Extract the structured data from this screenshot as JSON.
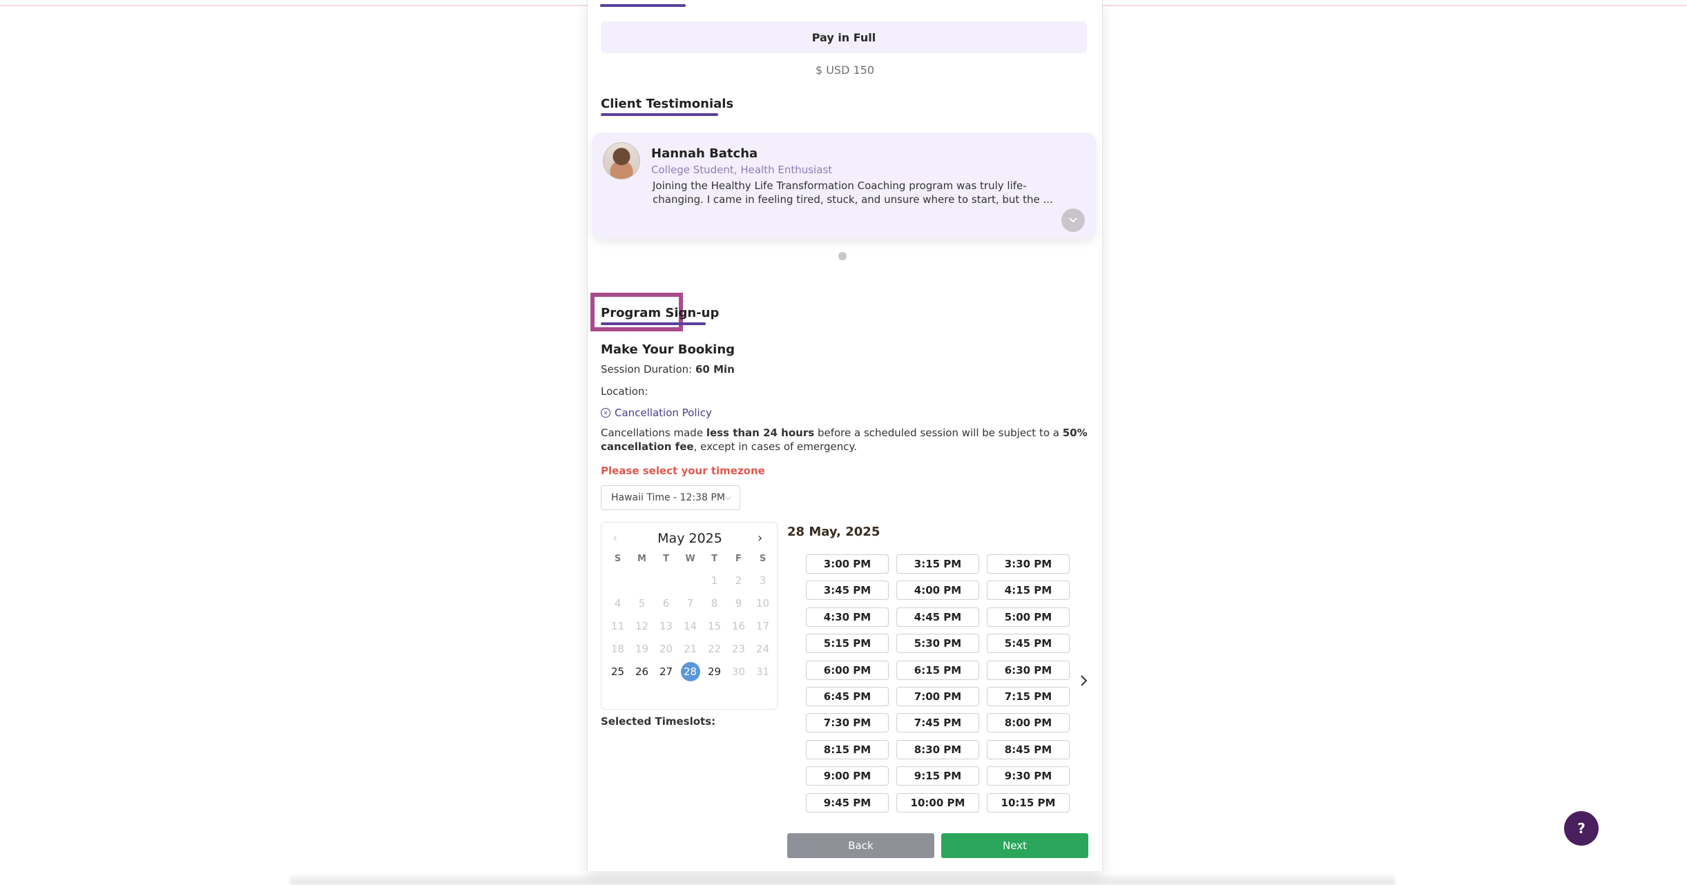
{
  "payment": {
    "pay_full_label": "Pay in Full",
    "price": "$ USD 150"
  },
  "testimonials": {
    "title": "Client Testimonials",
    "items": [
      {
        "name": "Hannah Batcha",
        "role": "College Student, Health Enthusiast",
        "text": "Joining the Healthy Life Transformation Coaching program was truly life-changing. I came in feeling tired, stuck, and unsure where to start, but the ..."
      }
    ],
    "expand_icon": "chevron-down-icon"
  },
  "signup": {
    "title": "Program Sign-up",
    "booking_title": "Make Your Booking",
    "duration_label": "Session Duration:",
    "duration_value": "60 Min",
    "location_label": "Location:",
    "cancel_link": "Cancellation Policy",
    "policy": {
      "p1": "Cancellations made ",
      "b1": "less than 24 hours",
      "p2": " before a scheduled session will be subject to a ",
      "b2": "50% cancellation fee",
      "p3": ", except in cases of emergency."
    },
    "tz_warning": "Please select your timezone",
    "tz_value": "Hawaii Time - 12:38 PM",
    "selected_timeslots_label": "Selected Timeslots:"
  },
  "calendar": {
    "month": "May 2025",
    "dow": [
      "S",
      "M",
      "T",
      "W",
      "T",
      "F",
      "S"
    ],
    "weeks": [
      [
        "",
        "",
        "",
        "",
        "1",
        "2",
        "3"
      ],
      [
        "4",
        "5",
        "6",
        "7",
        "8",
        "9",
        "10"
      ],
      [
        "11",
        "12",
        "13",
        "14",
        "15",
        "16",
        "17"
      ],
      [
        "18",
        "19",
        "20",
        "21",
        "22",
        "23",
        "24"
      ],
      [
        "25",
        "26",
        "27",
        "28",
        "29",
        "30",
        "31"
      ]
    ],
    "enabled_days": [
      "25",
      "26",
      "27",
      "28",
      "29"
    ],
    "selected_day": "28"
  },
  "slots": {
    "date_heading": "28 May, 2025",
    "times": [
      [
        "3:00 PM",
        "3:15 PM",
        "3:30 PM"
      ],
      [
        "3:45 PM",
        "4:00 PM",
        "4:15 PM"
      ],
      [
        "4:30 PM",
        "4:45 PM",
        "5:00 PM"
      ],
      [
        "5:15 PM",
        "5:30 PM",
        "5:45 PM"
      ],
      [
        "6:00 PM",
        "6:15 PM",
        "6:30 PM"
      ],
      [
        "6:45 PM",
        "7:00 PM",
        "7:15 PM"
      ],
      [
        "7:30 PM",
        "7:45 PM",
        "8:00 PM"
      ],
      [
        "8:15 PM",
        "8:30 PM",
        "8:45 PM"
      ],
      [
        "9:00 PM",
        "9:15 PM",
        "9:30 PM"
      ],
      [
        "9:45 PM",
        "10:00 PM",
        "10:15 PM"
      ]
    ]
  },
  "nav": {
    "back": "Back",
    "next": "Next"
  },
  "help": {
    "label": "?"
  }
}
